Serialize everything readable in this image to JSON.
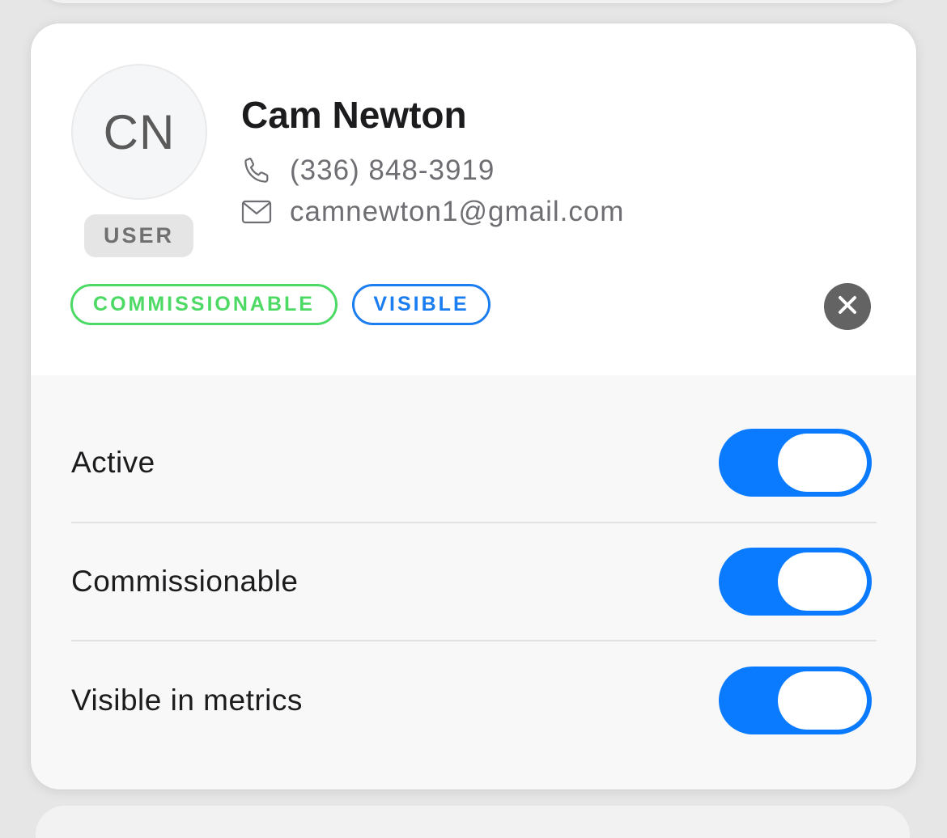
{
  "contact": {
    "initials": "CN",
    "role": "USER",
    "name": "Cam Newton",
    "phone": "(336) 848-3919",
    "email": "camnewton1@gmail.com"
  },
  "tags": [
    {
      "label": "COMMISSIONABLE",
      "color": "#4cd964"
    },
    {
      "label": "VISIBLE",
      "color": "#1a7df0"
    }
  ],
  "settings": [
    {
      "label": "Active",
      "enabled": true
    },
    {
      "label": "Commissionable",
      "enabled": true
    },
    {
      "label": "Visible in metrics",
      "enabled": true
    }
  ],
  "colors": {
    "toggle_on": "#0a7aff",
    "close_button": "#636363"
  },
  "icons": {
    "phone": "phone-icon",
    "email": "envelope-icon",
    "close": "close-icon"
  }
}
